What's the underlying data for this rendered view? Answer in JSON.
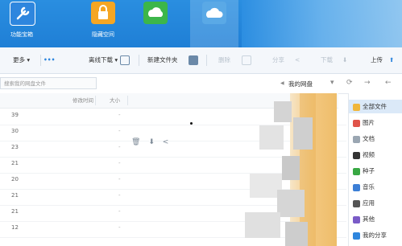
{
  "top_nav": {
    "buttons": [
      {
        "label": "功能宝箱",
        "icon": "wrench-icon",
        "color": "#2e86de"
      },
      {
        "label": "隐藏空间",
        "icon": "lock-icon",
        "color": "#f5a623"
      },
      {
        "label": "",
        "icon": "sync-cloud-icon",
        "color": "#3cb64a"
      },
      {
        "label": "",
        "icon": "cloud-icon",
        "color": "#5aa9e6"
      }
    ]
  },
  "toolbar": {
    "upload": "上传",
    "download": "下载",
    "share": "分享",
    "delete": "删除",
    "new_folder": "新建文件夹",
    "offline_download": "离线下载",
    "more": "更多"
  },
  "address_bar": {
    "breadcrumb": "我的网盘",
    "search_placeholder": "搜索我的网盘文件"
  },
  "columns": {
    "size": "大小",
    "modified": "修改时间"
  },
  "sidebar": {
    "items": [
      {
        "label": "全部文件",
        "icon": "folder-icon",
        "color": "#f0b63b",
        "active": true
      },
      {
        "label": "图片",
        "icon": "image-icon",
        "color": "#e0544a",
        "active": false
      },
      {
        "label": "文档",
        "icon": "document-icon",
        "color": "#9aa6b2",
        "active": false
      },
      {
        "label": "视频",
        "icon": "video-icon",
        "color": "#333333",
        "active": false
      },
      {
        "label": "种子",
        "icon": "bt-icon",
        "color": "#38a843",
        "active": false
      },
      {
        "label": "音乐",
        "icon": "music-icon",
        "color": "#3c7fd6",
        "active": false
      },
      {
        "label": "应用",
        "icon": "app-icon",
        "color": "#555555",
        "active": false
      },
      {
        "label": "其他",
        "icon": "other-icon",
        "color": "#7a5bc7",
        "active": false
      },
      {
        "label": "我的分享",
        "icon": "share-icon",
        "color": "#2e86de",
        "active": false
      }
    ]
  },
  "file_rows": [
    {
      "size": "39",
      "dash": "-"
    },
    {
      "size": "30",
      "dash": "-"
    },
    {
      "size": "23",
      "dash": "-"
    },
    {
      "size": "21",
      "dash": "-"
    },
    {
      "size": "20",
      "dash": "-"
    },
    {
      "size": "21",
      "dash": "-"
    },
    {
      "size": "21",
      "dash": "-"
    },
    {
      "size": "12",
      "dash": "-"
    }
  ],
  "colors": {
    "accent": "#1f7fd6",
    "toolbar_bg": "#f4f7fb",
    "selected_row": "#dbe9f8"
  }
}
